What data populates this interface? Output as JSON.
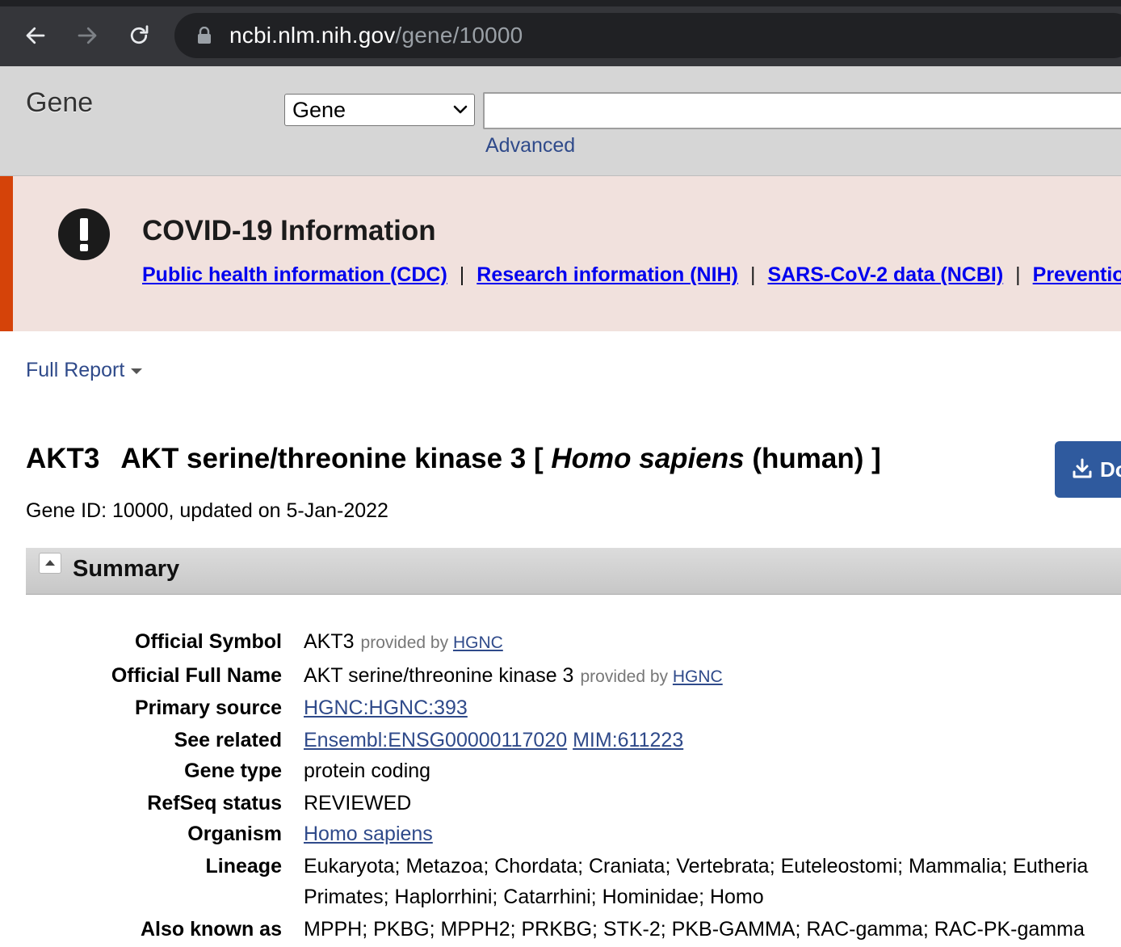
{
  "browser": {
    "url_host": "ncbi.nlm.nih.gov",
    "url_path": "/gene/10000"
  },
  "search": {
    "db_title": "Gene",
    "db_select_value": "Gene",
    "input_value": "",
    "advanced_label": "Advanced"
  },
  "covid": {
    "heading": "COVID-19 Information",
    "links": [
      "Public health information (CDC)",
      "Research information (NIH)",
      "SARS-CoV-2 data (NCBI)",
      "Prevention"
    ],
    "separator": "|"
  },
  "report": {
    "format_label": "Full Report"
  },
  "gene": {
    "symbol": "AKT3",
    "name": "AKT serine/threonine kinase 3 [",
    "organism_italic": "Homo sapiens",
    "organism_suffix": "(human) ]",
    "id_line": "Gene ID: 10000, updated on 5-Jan-2022",
    "download_label": "Do"
  },
  "summary": {
    "title": "Summary",
    "provided_by_text": "provided by",
    "provider": "HGNC",
    "rows": {
      "official_symbol": {
        "label": "Official Symbol",
        "value": "AKT3"
      },
      "official_full_name": {
        "label": "Official Full Name",
        "value": "AKT serine/threonine kinase 3"
      },
      "primary_source": {
        "label": "Primary source",
        "value": "HGNC:HGNC:393"
      },
      "see_related": {
        "label": "See related",
        "value_1": "Ensembl:ENSG00000117020",
        "value_2": "MIM:611223"
      },
      "gene_type": {
        "label": "Gene type",
        "value": "protein coding"
      },
      "refseq_status": {
        "label": "RefSeq status",
        "value": "REVIEWED"
      },
      "organism": {
        "label": "Organism",
        "value": "Homo sapiens"
      },
      "lineage": {
        "label": "Lineage",
        "value_line1": "Eukaryota; Metazoa; Chordata; Craniata; Vertebrata; Euteleostomi; Mammalia; Eutheria",
        "value_line2": "Primates; Haplorrhini; Catarrhini; Hominidae; Homo"
      },
      "also_known_as": {
        "label": "Also known as",
        "value": "MPPH; PKBG; MPPH2; PRKBG; STK-2; PKB-GAMMA; RAC-gamma; RAC-PK-gamma"
      }
    }
  }
}
